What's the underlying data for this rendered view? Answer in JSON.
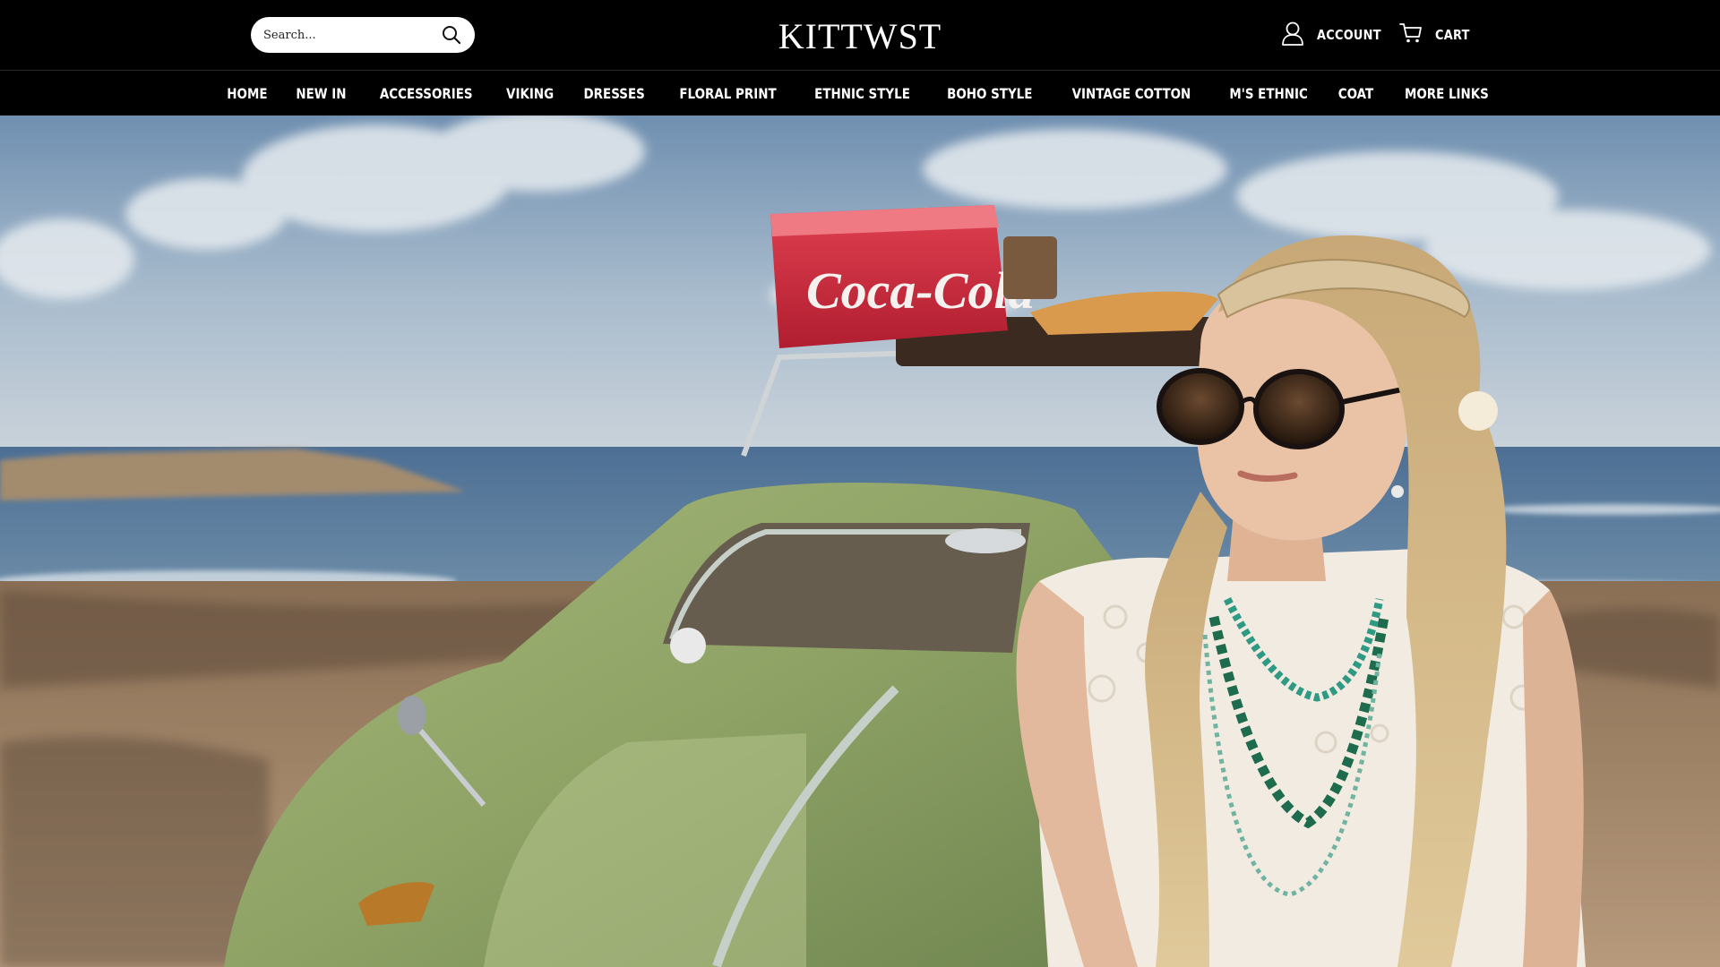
{
  "header": {
    "search": {
      "placeholder": "Search..."
    },
    "logo": "KITTWST",
    "account_label": "ACCOUNT",
    "cart_label": "CART"
  },
  "nav": {
    "items": [
      {
        "label": "HOME"
      },
      {
        "label": "NEW IN"
      },
      {
        "label": "ACCESSORIES"
      },
      {
        "label": "VIKING"
      },
      {
        "label": "DRESSES"
      },
      {
        "label": "FLORAL PRINT"
      },
      {
        "label": "ETHNIC STYLE"
      },
      {
        "label": "BOHO STYLE"
      },
      {
        "label": "VINTAGE COTTON"
      },
      {
        "label": "M'S ETHNIC"
      },
      {
        "label": "COAT"
      },
      {
        "label": "MORE LINKS"
      }
    ]
  },
  "hero": {
    "cooler_text": "Coca-Cola"
  },
  "colors": {
    "header_bg": "#000000",
    "header_text": "#ffffff",
    "search_bg": "#ffffff"
  },
  "icons": {
    "search": "search-icon",
    "account": "user-icon",
    "cart": "cart-icon"
  }
}
